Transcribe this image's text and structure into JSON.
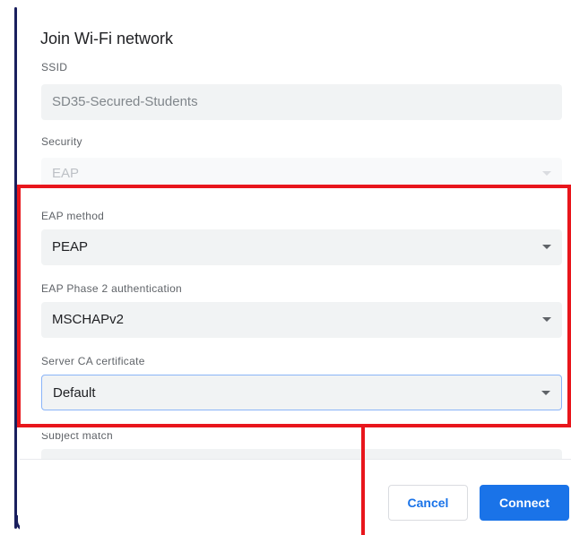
{
  "dialog": {
    "title": "Join Wi-Fi network",
    "ssid": {
      "label": "SSID",
      "value": "SD35-Secured-Students"
    },
    "security": {
      "label": "Security",
      "value": "EAP"
    },
    "eap_method": {
      "label": "EAP method",
      "value": "PEAP"
    },
    "phase2": {
      "label": "EAP Phase 2 authentication",
      "value": "MSCHAPv2"
    },
    "server_ca": {
      "label": "Server CA certificate",
      "value": "Default"
    },
    "subject_match": {
      "label": "Subject match",
      "value": ""
    }
  },
  "buttons": {
    "cancel": "Cancel",
    "connect": "Connect"
  },
  "colors": {
    "accent": "#1a73e8",
    "annotation": "#e8161c",
    "field_bg": "#f1f3f4",
    "focus_border": "#8ab4f8"
  },
  "icons": {
    "dropdown": "chevron-down-icon"
  }
}
